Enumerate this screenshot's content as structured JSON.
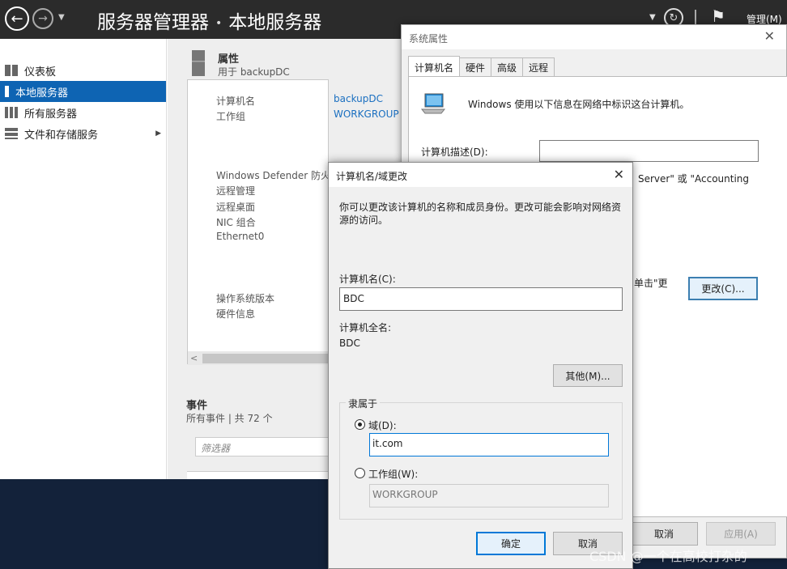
{
  "server_manager": {
    "breadcrumb": {
      "app": "服务器管理器",
      "separator": "•",
      "page": "本地服务器"
    },
    "header_manage": "管理(M)",
    "sidebar": {
      "items": [
        {
          "label": "仪表板",
          "icon": "dashboard-icon",
          "active": false
        },
        {
          "label": "本地服务器",
          "icon": "server-icon",
          "active": true
        },
        {
          "label": "所有服务器",
          "icon": "servers-icon",
          "active": false
        },
        {
          "label": "文件和存储服务",
          "icon": "storage-icon",
          "active": false,
          "expandable": true
        }
      ]
    },
    "properties": {
      "title": "属性",
      "subtitle": "用于 backupDC",
      "rows": [
        {
          "label": "计算机名",
          "value": "backupDC"
        },
        {
          "label": "工作组",
          "value": "WORKGROUP"
        },
        {
          "label": "Windows Defender 防火墙",
          "value": ""
        },
        {
          "label": "远程管理",
          "value": ""
        },
        {
          "label": "远程桌面",
          "value": ""
        },
        {
          "label": "NIC 组合",
          "value": ""
        },
        {
          "label": "Ethernet0",
          "value": ""
        },
        {
          "label": "操作系统版本",
          "value": ""
        },
        {
          "label": "硬件信息",
          "value": ""
        }
      ]
    },
    "events": {
      "title": "事件",
      "subtitle": "所有事件 | 共 72 个",
      "filter_placeholder": "筛选器"
    }
  },
  "system_properties": {
    "title": "系统属性",
    "tabs": [
      {
        "label": "计算机名",
        "active": true
      },
      {
        "label": "硬件",
        "active": false
      },
      {
        "label": "高级",
        "active": false
      },
      {
        "label": "远程",
        "active": false
      }
    ],
    "identify_text": "Windows 使用以下信息在网络中标识这台计算机。",
    "computer_description_label": "计算机描述(D):",
    "computer_description_value": "",
    "example_text_partial": "Server\" 或 \"Accounting",
    "click_change_partial": "单击\"更",
    "change_button": "更改(C)...",
    "cancel_button": "取消",
    "apply_button": "应用(A)"
  },
  "computer_name_dialog": {
    "title": "计算机名/域更改",
    "intro": "你可以更改该计算机的名称和成员身份。更改可能会影响对网络资源的访问。",
    "name_label": "计算机名(C):",
    "name_value": "BDC",
    "full_name_label": "计算机全名:",
    "full_name_value": "BDC",
    "more_button": "其他(M)...",
    "member_of_legend": "隶属于",
    "domain_label": "域(D):",
    "domain_value": "it.com",
    "domain_selected": true,
    "workgroup_label": "工作组(W):",
    "workgroup_value": "WORKGROUP",
    "ok_button": "确定",
    "cancel_button": "取消"
  },
  "watermark": "CSDN @一个在高校打杂的",
  "colors": {
    "accent": "#0e64b3",
    "header_bg": "#2b2b2b",
    "link": "#1a6fc0",
    "focus_border": "#0078d7"
  }
}
